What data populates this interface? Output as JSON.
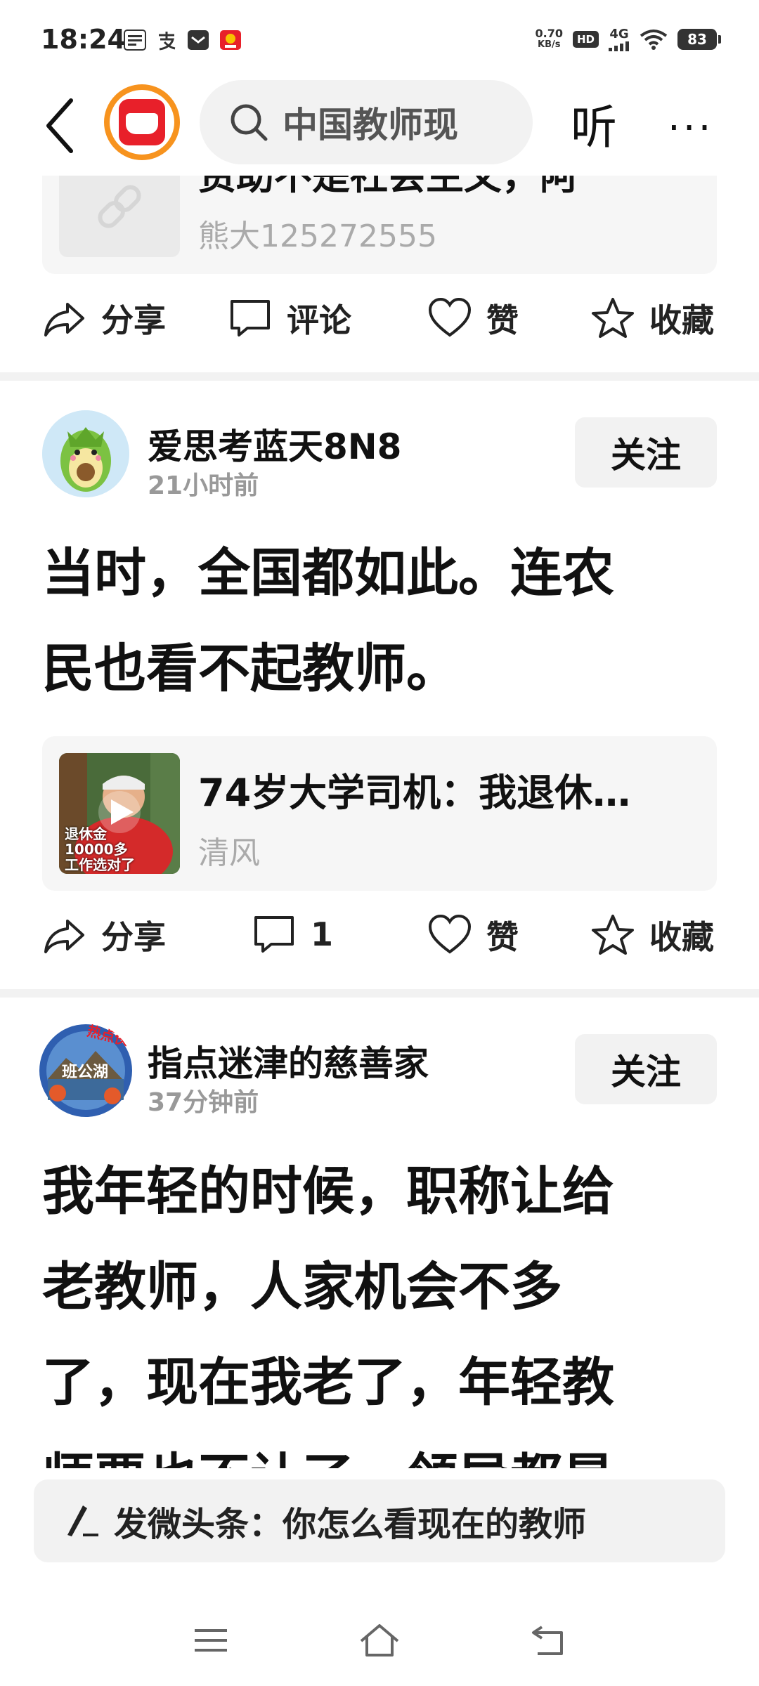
{
  "status_bar": {
    "time": "18:24",
    "net_speed_value": "0.70",
    "net_speed_unit": "KB/s",
    "hd": "HD",
    "signal": "4G",
    "battery": "83"
  },
  "header": {
    "search_text": "中国教师现",
    "listen_label": "听",
    "more_label": "···"
  },
  "posts": [
    {
      "link_card": {
        "title": "资助不是社会主义，阿",
        "author": "熊大125272555"
      },
      "actions": {
        "share": "分享",
        "comment": "评论",
        "like": "赞",
        "favorite": "收藏"
      }
    },
    {
      "user": "爱思考蓝天8N8",
      "time": "21小时前",
      "follow_label": "关注",
      "body_line1": "当时，全国都如此。连农",
      "body_line2": "民也看不起教师。",
      "link_card": {
        "title": "74岁大学司机：我退休…",
        "author": "清风",
        "thumb_text_1": "退休金",
        "thumb_text_2": "10000多",
        "thumb_text_3": "工作选对了"
      },
      "actions": {
        "share": "分享",
        "comment": "1",
        "like": "赞",
        "favorite": "收藏"
      }
    },
    {
      "user": "指点迷津的慈善家",
      "time": "37分钟前",
      "follow_label": "关注",
      "avatar_badge": "热点侠",
      "avatar_text": "班公湖",
      "body_line1": "我年轻的时候，职称让给",
      "body_line2": "老教师，人家机会不多",
      "body_line3": "了，现在我老了，年轻教",
      "body_line4": "师要也不让了，领导都是"
    }
  ],
  "composer": {
    "text": "发微头条：你怎么看现在的教师"
  },
  "colors": {
    "accent_orange": "#f7931e",
    "brand_red": "#e8202a",
    "card_bg": "#f6f6f6",
    "muted_text": "#999999"
  }
}
